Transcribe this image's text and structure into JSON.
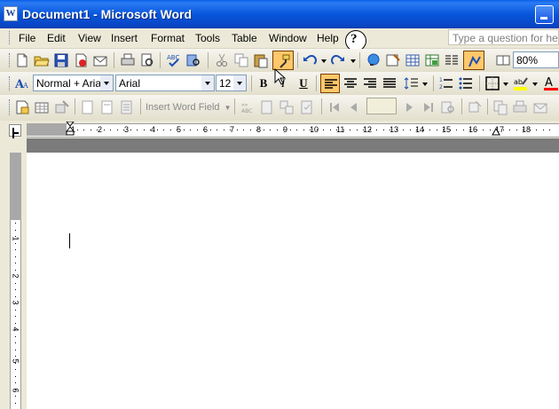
{
  "window": {
    "title": "Document1 - Microsoft Word",
    "app_icon": "W"
  },
  "menu": {
    "items": [
      "File",
      "Edit",
      "View",
      "Insert",
      "Format",
      "Tools",
      "Table",
      "Window",
      "Help"
    ],
    "help_placeholder": "Type a question for help"
  },
  "standard_toolbar": {
    "zoom": "80%",
    "icons": [
      "new-document-icon",
      "open-icon",
      "save-icon",
      "permission-icon",
      "email-icon",
      "print-icon",
      "print-preview-icon",
      "spelling-icon",
      "research-icon",
      "cut-icon",
      "copy-icon",
      "paste-icon",
      "format-painter-icon",
      "undo-icon",
      "redo-icon",
      "insert-hyperlink-icon",
      "tables-borders-icon",
      "insert-table-icon",
      "insert-excel-icon",
      "columns-icon",
      "drawing-icon",
      "document-map-icon",
      "show-hide-icon",
      "reading-mode-icon"
    ]
  },
  "formatting_toolbar": {
    "style": "Normal + Arial",
    "font": "Arial",
    "size": "12",
    "bold": "B",
    "italic": "I",
    "underline": "U",
    "alignment_active": "align-left"
  },
  "mail_merge_toolbar": {
    "insert_word_field": "Insert Word Field"
  },
  "ruler": {
    "numbers": [
      "1",
      "1",
      "2",
      "3",
      "4",
      "5",
      "6",
      "7",
      "8",
      "9",
      "10",
      "11",
      "12",
      "13",
      "14",
      "15",
      "16",
      "17",
      "18"
    ]
  },
  "vertical_ruler": {
    "numbers": [
      "2",
      "1",
      "1",
      "2",
      "3",
      "4",
      "5",
      "6"
    ]
  },
  "colors": {
    "titlebar": "#0856dc",
    "chrome": "#ece9d8",
    "active_button": "#ffc86b"
  }
}
